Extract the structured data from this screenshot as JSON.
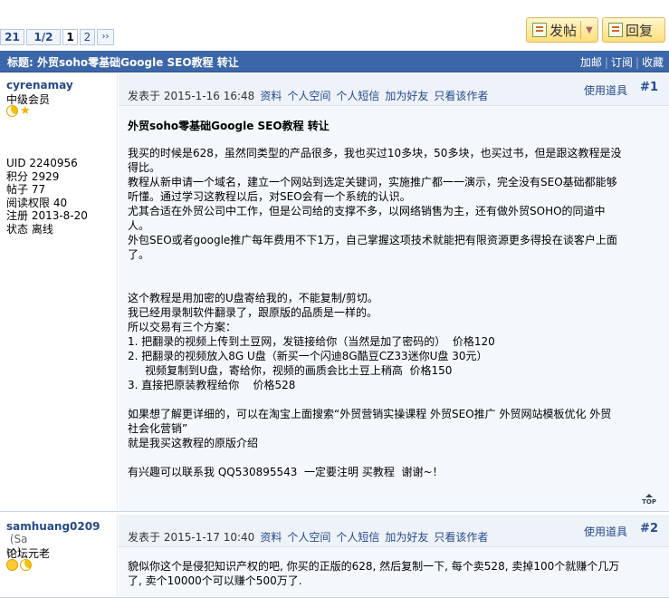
{
  "toolbar": {
    "post_label": "发帖",
    "reply_label": "回复"
  },
  "pager": {
    "total": "21",
    "fraction": "1/2",
    "current": "1",
    "page2": "2",
    "next": "››"
  },
  "thread": {
    "title": "标题: 外贸soho零基础Google SEO教程 转让",
    "actions": [
      "加邮",
      "订阅",
      "收藏"
    ]
  },
  "posts": [
    {
      "username": "cyrenamay",
      "username_extra": "",
      "rank": "中级会员",
      "stats": [
        "UID 2240956",
        "积分 2929",
        "帖子 77",
        "阅读权限 40",
        "注册 2013-8-20",
        "状态 离线"
      ],
      "posted": "发表于 2015-1-16 16:48",
      "links": [
        "资料",
        "个人空间",
        "个人短信",
        "加为好友",
        "只看该作者"
      ],
      "tools": "使用道具",
      "floor": "#1",
      "post_title": "外贸soho零基础Google SEO教程 转让",
      "body": "我买的时候是628，虽然同类型的产品很多，我也买过10多块，50多块，也买过书，但是跟这教程是没\n得比。\n教程从新申请一个域名，建立一个网站到选定关键词，实施推广都一一演示，完全没有SEO基础都能够\n听懂。通过学习这教程以后，对SEO会有一个系统的认识。\n尤其合适在外贸公司中工作，但是公司给的支撑不多，以网络销售为主，还有做外贸SOHO的同道中\n人。\n外包SEO或者google推广每年费用不下1万，自己掌握这项技术就能把有限资源更多得投在谈客户上面\n了。\n\n\n这个教程是用加密的U盘寄给我的，不能复制/剪切。\n我已经用录制软件翻录了，跟原版的品质是一样的。\n所以交易有三个方案：\n1. 把翻录的视频上传到土豆网，发链接给你（当然是加了密码的）  价格120\n2. 把翻录的视频放入8G U盘（新买一个闪迪8G酷豆CZ33迷你U盘 30元）\n     视频复制到U盘，寄给你，视频的画质会比土豆上稍高  价格150\n3. 直接把原装教程给你    价格528\n\n如果想了解更详细的，可以在淘宝上面搜索“外贸营销实操课程 外贸SEO推广 外贸网站模板优化 外贸\n社会化营销”\n就是我买这教程的原版介绍\n\n有兴趣可以联系我 QQ530895543  一定要注明 买教程  谢谢~！",
      "top_label": "TOP"
    },
    {
      "username": "samhuang0209",
      "username_extra": " (Sa\nm)",
      "rank": "论坛元老",
      "posted": "发表于 2015-1-17 10:40",
      "links": [
        "资料",
        "个人空间",
        "个人短信",
        "加为好友",
        "只看该作者"
      ],
      "tools": "使用道具",
      "floor": "#2",
      "body": "貌似你这个是侵犯知识产权的吧, 你买的正版的628, 然后复制一下, 每个卖528, 卖掉100个就赚个几万\n了, 卖个10000个可以赚个500万了."
    }
  ],
  "colors": {
    "titlebar": "#3c66a8",
    "link": "#254a8a",
    "button": "#ffde7a"
  }
}
